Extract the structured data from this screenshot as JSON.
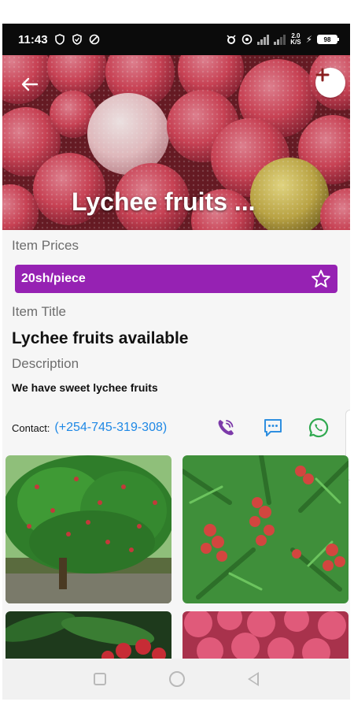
{
  "status_bar": {
    "time": "11:43",
    "net_speed_top": "2.0",
    "net_speed_bottom": "K/S",
    "battery": "98"
  },
  "hero": {
    "title": "Lychee fruits ...",
    "back_icon": "arrow-left-icon",
    "add_icon": "plus-icon"
  },
  "details": {
    "prices_label": "Item Prices",
    "price": "20sh/piece",
    "title_label": "Item Title",
    "title": "Lychee fruits available",
    "description_label": "Description",
    "description": "We have sweet lychee fruits",
    "contact_label": "Contact:",
    "contact_phone": "(+254-745-319-308)"
  },
  "colors": {
    "price_bar": "#9622b3",
    "viber": "#7c3aa9",
    "sms": "#2f8fe0",
    "whatsapp": "#2fa84f",
    "link": "#1e88e5"
  },
  "gallery": {
    "images": [
      "lychee-tree",
      "lychee-branches",
      "lychee-leaves",
      "lychee-fruits"
    ]
  }
}
